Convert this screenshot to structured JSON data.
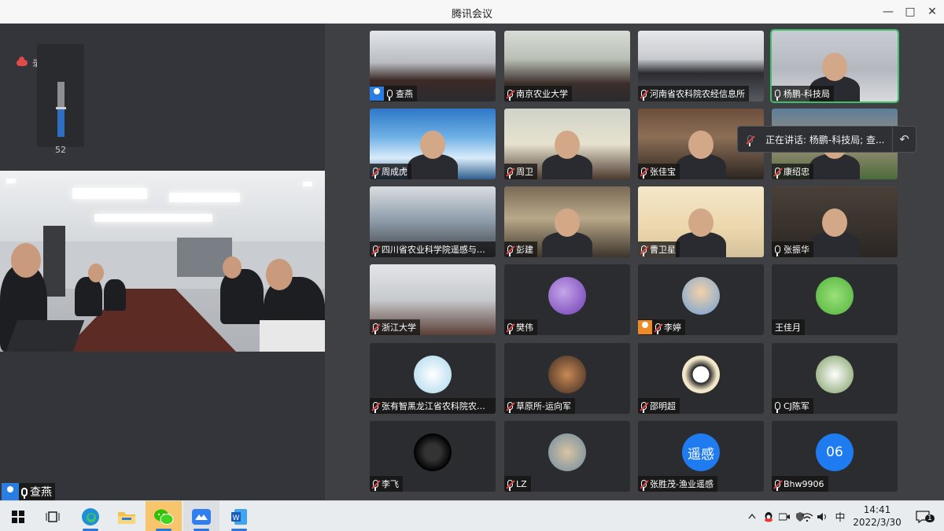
{
  "window": {
    "title": "腾讯会议"
  },
  "recording": {
    "label": "录制中",
    "volume": 52
  },
  "main_speaker": {
    "name": "查燕"
  },
  "speaking_banner": {
    "text": "正在讲话: 杨鹏-科技局; 查..."
  },
  "tiles": [
    {
      "name": "查燕",
      "mic": "on",
      "avatar": true,
      "avatar_color": "#2a7de1"
    },
    {
      "name": "南京农业大学",
      "mic": "off"
    },
    {
      "name": "河南省农科院农经信息所",
      "mic": "off"
    },
    {
      "name": "杨鹏-科技局",
      "mic": "on",
      "active": true
    },
    {
      "name": "周成虎",
      "mic": "off"
    },
    {
      "name": "周卫",
      "mic": "off"
    },
    {
      "name": "张佳宝",
      "mic": "off"
    },
    {
      "name": "康绍忠",
      "mic": "off"
    },
    {
      "name": "四川省农业科学院遥感与数...",
      "mic": "off"
    },
    {
      "name": "彭建",
      "mic": "off"
    },
    {
      "name": "曹卫星",
      "mic": "off"
    },
    {
      "name": "张振华",
      "mic": "on"
    },
    {
      "name": "浙江大学",
      "mic": "off"
    },
    {
      "name": "樊伟",
      "mic": "off"
    },
    {
      "name": "李婷",
      "mic": "off",
      "avatar": true,
      "avatar_color": "#f08a24"
    },
    {
      "name": "王佳月",
      "mic": "none"
    },
    {
      "name": "张有智黑龙江省农科院农业...",
      "mic": "off"
    },
    {
      "name": "草原所-运向军",
      "mic": "off"
    },
    {
      "name": "邵明超",
      "mic": "off"
    },
    {
      "name": "CJ陈军",
      "mic": "on"
    },
    {
      "name": "李飞",
      "mic": "off"
    },
    {
      "name": "LZ",
      "mic": "off"
    },
    {
      "name": "张胜茂-渔业遥感",
      "mic": "off"
    },
    {
      "name": "Bhw9906",
      "mic": "off"
    }
  ],
  "avatar_texts": {
    "yaogan": "遥感",
    "n06": "06"
  },
  "taskbar": {
    "apps": [
      "start-icon",
      "task-view-icon",
      "edge-icon",
      "file-explorer-icon",
      "wechat-icon",
      "tencent-meeting-icon",
      "word-icon"
    ],
    "ime": "中",
    "time": "14:41",
    "date": "2022/3/30",
    "notification_count": "1"
  }
}
